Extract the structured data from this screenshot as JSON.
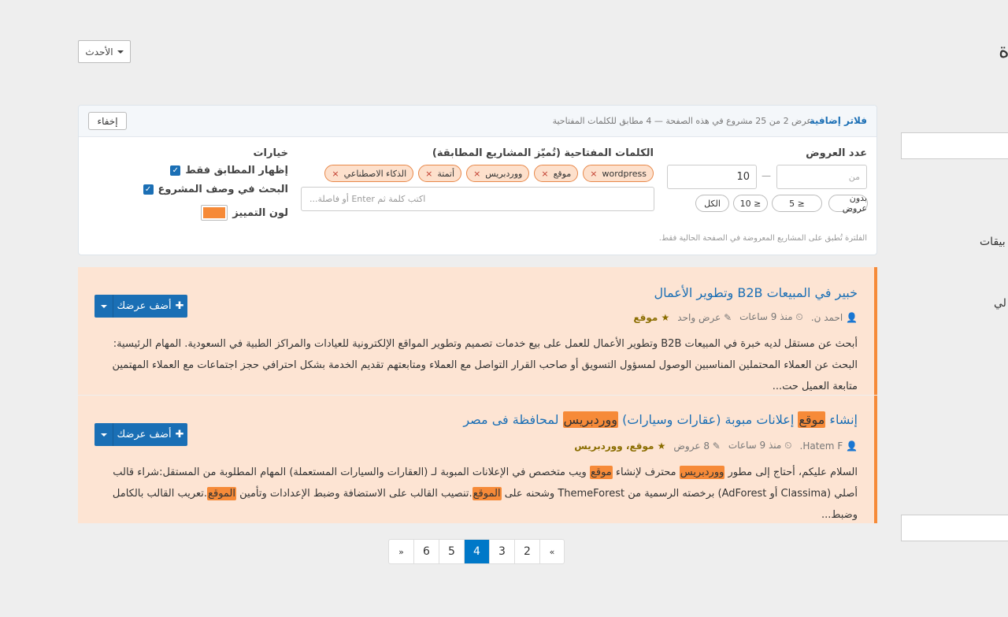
{
  "page": {
    "title_fragment": "ة"
  },
  "sidebar": {
    "text1": "بيقات",
    "text2": "لي"
  },
  "sort": {
    "label": "الأحدث"
  },
  "filter_panel": {
    "title": "فلاتر إضافية",
    "summary": "عرض 2 من 25 مشروع في هذه الصفحة — 4 مطابق للكلمات المفتاحية",
    "hide_label": "إخفاء",
    "count_label": "عدد العروض",
    "min_placeholder": "من",
    "max_value": "10",
    "chips": [
      "بدون عروض",
      "≤ 5",
      "≤ 10",
      "الكل"
    ],
    "keywords_label": "الكلمات المفتاحية (تُميّز المشاريع المطابقة)",
    "keywords": [
      "wordpress",
      "موقع",
      "ووردبريس",
      "أتمتة",
      "الذكاء الاصطناعي"
    ],
    "keyword_placeholder": "اكتب كلمة ثم Enter أو فاصلة...",
    "options_label": "خيارات",
    "opt_match_only": "إظهار المطابق فقط",
    "opt_search_desc": "البحث في وصف المشروع",
    "opt_color": "لون التمييز",
    "highlight_color": "#f68a38",
    "note": "الفلترة تُطبق على المشاريع المعروضة في الصفحة الحالية فقط."
  },
  "projects": [
    {
      "title": "خبير في المبيعات B2B وتطوير الأعمال",
      "author": "احمد ن.",
      "time": "منذ 9 ساعات",
      "offers": "عرض واحد",
      "matched": "موقع",
      "desc": "أبحث عن مستقل لديه خبرة في المبيعات B2B وتطوير الأعمال للعمل على بيع خدمات تصميم وتطوير المواقع الإلكترونية للعيادات والمراكز الطبية في السعودية. المهام الرئيسية: البحث عن العملاء المحتملين المناسبين الوصول لمسؤول التسويق أو صاحب القرار التواصل مع العملاء ومتابعتهم تقديم الخدمة بشكل احترافي حجز اجتماعات مع العملاء المهتمين متابعة العميل حت...",
      "offer_label": "أضف عرضك"
    },
    {
      "title_parts": [
        "إنشاء ",
        "موقع",
        " إعلانات مبوبة (عقارات وسيارات) ",
        "ووردبريس",
        " لمحافظة فى مصر"
      ],
      "author": "Hatem F.",
      "time": "منذ 9 ساعات",
      "offers": "8 عروض",
      "matched": "موقع، ووردبريس",
      "desc_parts": [
        "السلام عليكم، أحتاج إلى مطور ",
        "ووردبريس",
        " محترف لإنشاء ",
        "موقع",
        " ويب متخصص في الإعلانات المبوبة لـ (العقارات والسيارات المستعملة) المهام المطلوبة من المستقل:شراء قالب أصلي (Classima أو AdForest) برخصته الرسمية من ThemeForest وشحنه على ",
        "الموقع",
        ".تنصيب القالب على الاستضافة وضبط الإعدادات وتأمين ",
        "الموقع",
        ".تعريب القالب بالكامل وضبط..."
      ],
      "offer_label": "أضف عرضك"
    }
  ],
  "pagination": {
    "prev": "«",
    "pages": [
      "2",
      "3",
      "4",
      "5",
      "6"
    ],
    "current": "4",
    "next": "»"
  }
}
